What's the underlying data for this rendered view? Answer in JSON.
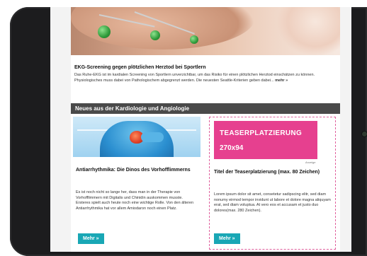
{
  "hero": {
    "image": "ekg-electrodes-photo"
  },
  "article": {
    "title": "EKG-Screening gegen plötzlichen Herztod bei Sportlern",
    "text": "Das Ruhe-EKG ist im kardialen Screening von Sportlern unverzichtbar, um das Risiko für einen plötzlichen Herztod einschätzen zu können. Physiologisches muss dabei von Pathologischem abgegrenzt werden. Die neuesten Seattle-Kriterien geben dabei...",
    "more": "mehr »"
  },
  "section": {
    "title": "Neues aus der Kardiologie und Angiologie"
  },
  "left_card": {
    "image": "heart-illustration",
    "title": "Antiarrhythmika: Die Dinos des Vorhofflimmerns",
    "text": "Es ist noch nicht so lange her, dass man in der Therapie von Vorhofflimmern mit Digitalis und Chinidin auskommen musste. Ersteres spielt auch heute noch eine wichtige Rolle. Von den älteren Antiarrhythmika hat vor allem Amiodaron noch einen Platz.",
    "button": "Mehr »"
  },
  "right_card": {
    "teaser_line1": "TEASERPLATZIERUNG",
    "teaser_line2": "270x94",
    "anzeige": "Anzeige",
    "title": "Titel der Teaserplatzierung (max. 80 Zeichen)",
    "text": "Lorem ipsum dolor sit amet, consetetur sadipscing elitr, sed diam nonumy eirmod tempor invidunt ut labore et dolore magna aliquyam erat, sed diam voluptua. At vero eos et accusam et justo duo dolores(max. 280 Zeichen).",
    "button": "Mehr »"
  },
  "colors": {
    "accent_button": "#19a7b5",
    "teaser_pink": "#e6408f",
    "section_bar": "#4a4a4a",
    "tablet_frame": "#1c1c1e"
  }
}
